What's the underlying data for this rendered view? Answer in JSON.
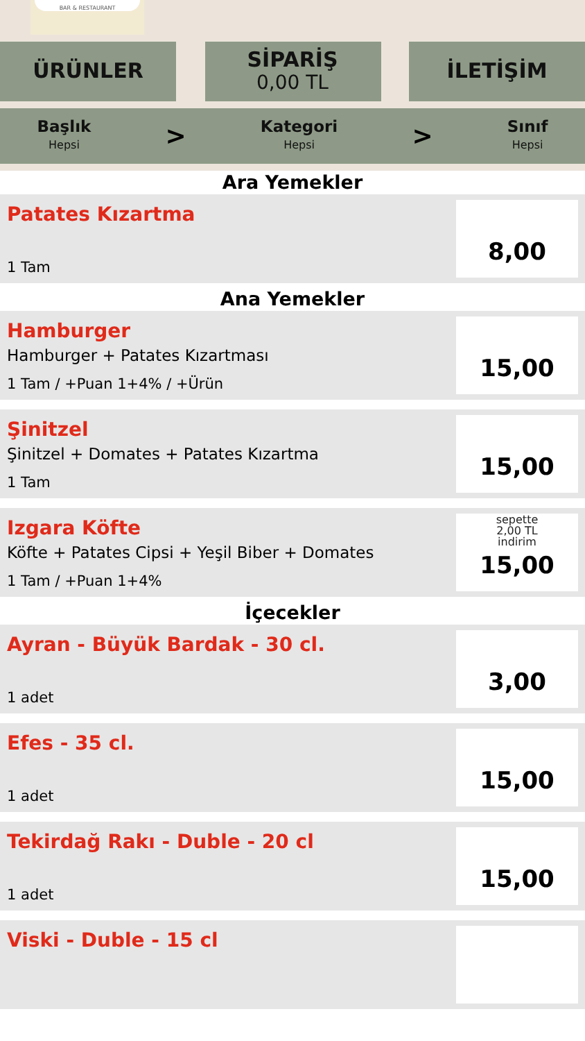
{
  "logo": {
    "caption": "BAR & RESTAURANT"
  },
  "nav": [
    {
      "label": "ÜRÜNLER"
    },
    {
      "label": "SİPARİŞ",
      "sub": "0,00 TL"
    },
    {
      "label": "İLETİŞİM"
    }
  ],
  "filters": [
    {
      "label": "Başlık",
      "value": "Hepsi"
    },
    {
      "label": "Kategori",
      "value": "Hepsi"
    },
    {
      "label": "Sınıf",
      "value": "Hepsi"
    }
  ],
  "separator": ">",
  "sections": [
    {
      "title": "Ara Yemekler",
      "items": [
        {
          "name": "Patates Kızartma",
          "quantity": "1 Tam",
          "price": "8,00"
        }
      ]
    },
    {
      "title": "Ana Yemekler",
      "items": [
        {
          "name": "Hamburger",
          "description": "Hamburger + Patates Kızartması",
          "quantity": "1 Tam / +Puan 1+4% / +Ürün",
          "price": "15,00"
        },
        {
          "name": "Şinitzel",
          "description": "Şinitzel + Domates + Patates Kızartma",
          "quantity": "1 Tam",
          "price": "15,00"
        },
        {
          "name": "Izgara Köfte",
          "description": "Köfte + Patates Cipsi + Yeşil Biber + Domates",
          "quantity": "1 Tam / +Puan 1+4%",
          "price": "15,00",
          "discount": [
            "sepette",
            "2,00 TL",
            "indirim"
          ]
        }
      ]
    },
    {
      "title": "İçecekler",
      "items": [
        {
          "name": "Ayran - Büyük Bardak - 30 cl.",
          "quantity": "1 adet",
          "price": "3,00"
        },
        {
          "name": "Efes - 35 cl.",
          "quantity": "1 adet",
          "price": "15,00"
        },
        {
          "name": "Tekirdağ Rakı - Duble - 20 cl",
          "quantity": "1 adet",
          "price": "15,00"
        },
        {
          "name": "Viski - Duble - 15 cl"
        }
      ]
    }
  ]
}
